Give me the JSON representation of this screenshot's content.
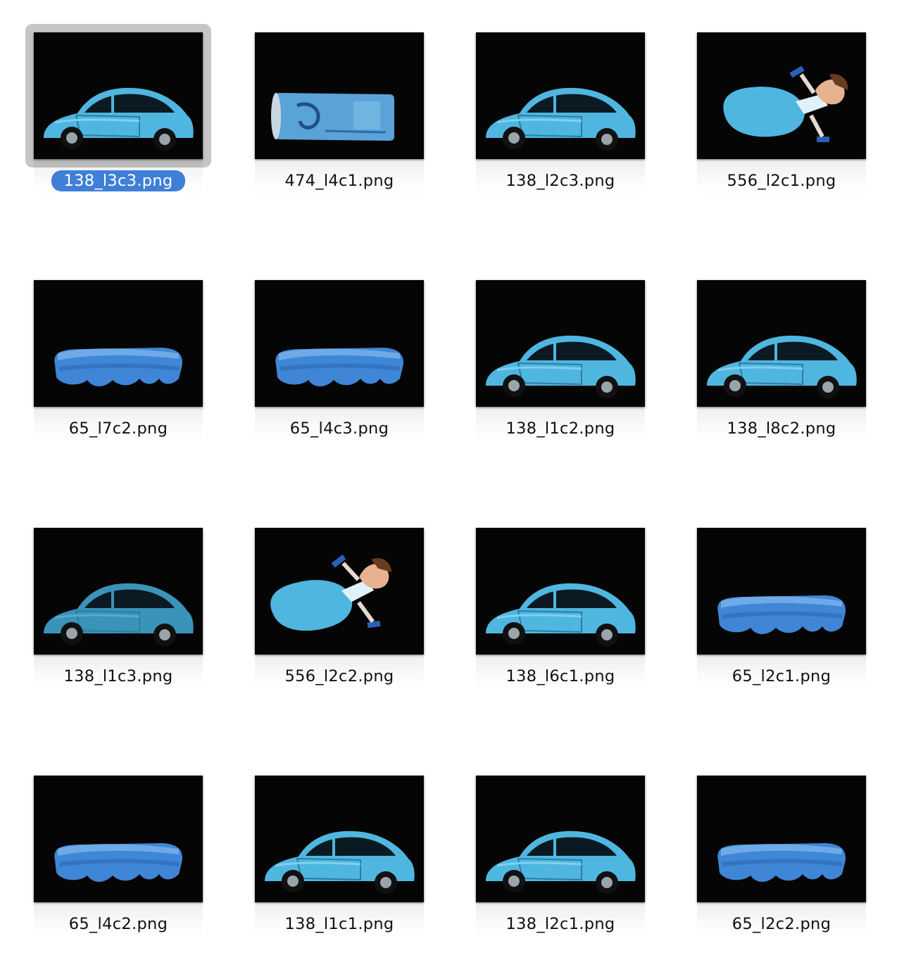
{
  "colors": {
    "selection_label_bg": "#3f7fd8",
    "selection_frame": "#c6c6c6",
    "object_blue": "#4fb6e0",
    "background": "#ffffff"
  },
  "files": [
    {
      "name": "138_l3c3.png",
      "subject": "car",
      "selected": true
    },
    {
      "name": "474_l4c1.png",
      "subject": "can",
      "selected": false
    },
    {
      "name": "138_l2c3.png",
      "subject": "car",
      "selected": false
    },
    {
      "name": "556_l2c1.png",
      "subject": "figurine",
      "selected": false
    },
    {
      "name": "65_l7c2.png",
      "subject": "sponge",
      "selected": false
    },
    {
      "name": "65_l4c3.png",
      "subject": "sponge",
      "selected": false
    },
    {
      "name": "138_l1c2.png",
      "subject": "car",
      "selected": false
    },
    {
      "name": "138_l8c2.png",
      "subject": "car",
      "selected": false
    },
    {
      "name": "138_l1c3.png",
      "subject": "car",
      "selected": false
    },
    {
      "name": "556_l2c2.png",
      "subject": "figurine",
      "selected": false
    },
    {
      "name": "138_l6c1.png",
      "subject": "car",
      "selected": false
    },
    {
      "name": "65_l2c1.png",
      "subject": "sponge",
      "selected": false
    },
    {
      "name": "65_l4c2.png",
      "subject": "sponge",
      "selected": false
    },
    {
      "name": "138_l1c1.png",
      "subject": "car",
      "selected": false
    },
    {
      "name": "138_l2c1.png",
      "subject": "car",
      "selected": false
    },
    {
      "name": "65_l2c2.png",
      "subject": "sponge",
      "selected": false
    }
  ]
}
